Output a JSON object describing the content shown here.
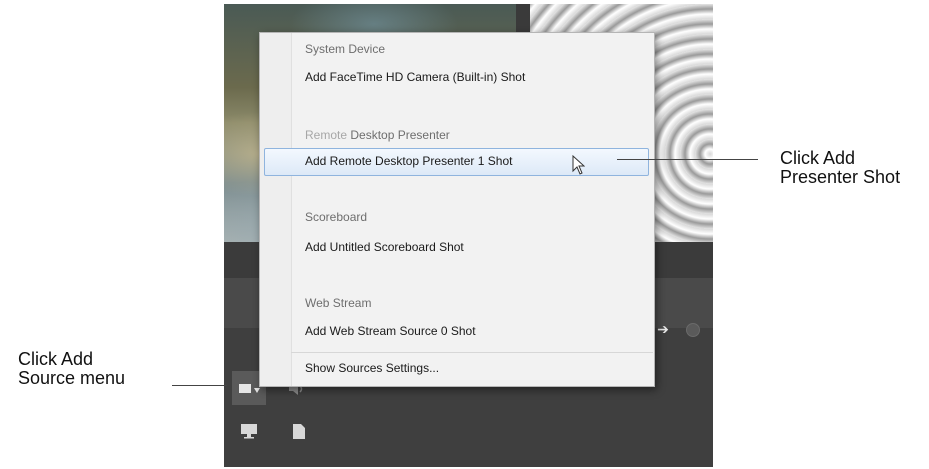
{
  "menu": {
    "sections": [
      {
        "header": "System Device",
        "item": "Add FaceTime HD Camera (Built-in) Shot"
      },
      {
        "header_faint": "Remote",
        "header": " Desktop Presenter",
        "item": "Add Remote Desktop Presenter 1 Shot",
        "highlighted": true
      },
      {
        "header": "Scoreboard",
        "item": "Add Untitled Scoreboard Shot"
      },
      {
        "header": "Web Stream",
        "item": "Add Web Stream Source 0 Shot"
      }
    ],
    "footer_item": "Show Sources Settings..."
  },
  "callouts": {
    "presenter": [
      "Click Add",
      "Presenter Shot"
    ],
    "source": [
      "Click Add",
      "Source menu"
    ]
  },
  "icons": {
    "add_source": "camera-icon",
    "dropdown": "dropdown-caret-icon",
    "audio": "speaker-icon",
    "display": "monitor-icon",
    "document": "document-icon",
    "arrow": "arrow-right-icon",
    "cursor": "mouse-pointer-icon"
  },
  "colors": {
    "menu_background": "#f2f2f2",
    "highlight_border": "#8fb4de",
    "app_dark": "#454545"
  }
}
